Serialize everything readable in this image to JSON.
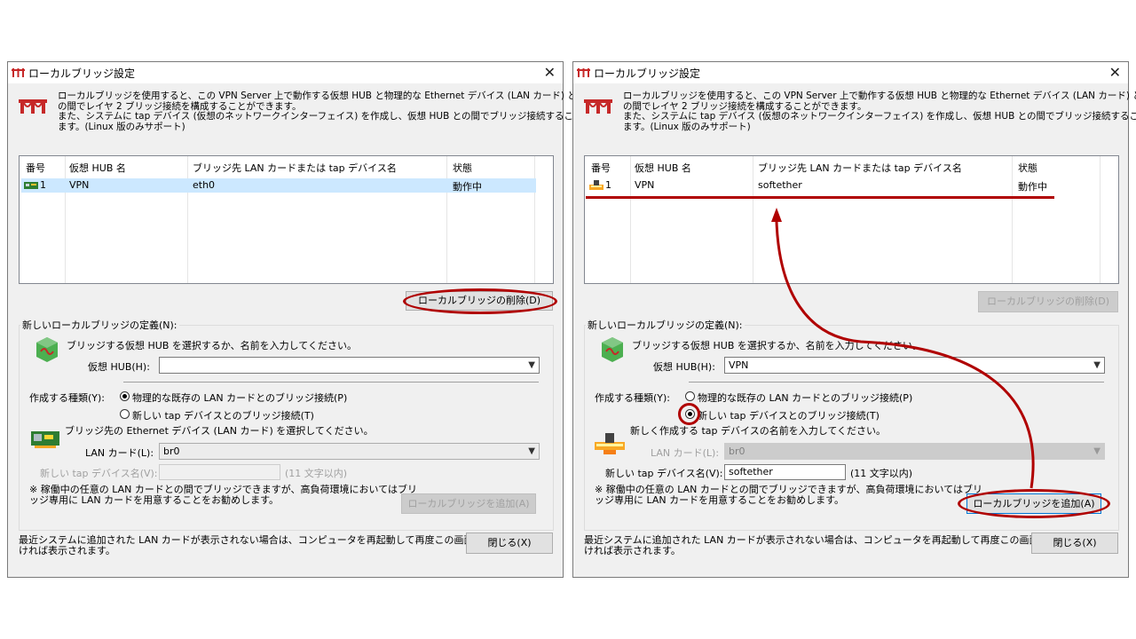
{
  "left": {
    "title": "ローカルブリッジ設定",
    "close": "✕",
    "description": [
      "ローカルブリッジを使用すると、この VPN Server 上で動作する仮想 HUB と物理的な Ethernet デバイス (LAN カード) と",
      "の間でレイヤ 2 ブリッジ接続を構成することができます。",
      "また、システムに tap デバイス (仮想のネットワークインターフェイス) を作成し、仮想 HUB との間でブリッジ接続することもでき",
      "ます。(Linux 版のみサポート)"
    ],
    "columns": [
      "番号",
      "仮想 HUB 名",
      "ブリッジ先 LAN カードまたは tap デバイス名",
      "状態"
    ],
    "row": {
      "num": "1",
      "hub": "VPN",
      "device": "eth0",
      "status": "動作中"
    },
    "delete_button": "ローカルブリッジの削除(D)",
    "group_title": "新しいローカルブリッジの定義(N):",
    "hub_instruction": "ブリッジする仮想 HUB を選択するか、名前を入力してください。",
    "hub_label": "仮想 HUB(H):",
    "hub_value": "",
    "type_label": "作成する種類(Y):",
    "radio_physical": "物理的な既存の LAN カードとのブリッジ接続(P)",
    "radio_tap": "新しい tap デバイスとのブリッジ接続(T)",
    "device_instruction": "ブリッジ先の Ethernet デバイス (LAN カード) を選択してください。",
    "lan_label": "LAN カード(L):",
    "lan_value": "br0",
    "tap_label": "新しい tap デバイス名(V):",
    "tap_value": "",
    "tap_hint": "(11 文字以内)",
    "note": [
      "※ 稼働中の任意の LAN カードとの間でブリッジできますが、高負荷環境においてはブリ",
      "ッジ専用に LAN カードを用意することをお勧めします。"
    ],
    "add_button": "ローカルブリッジを追加(A)",
    "footer": [
      "最近システムに追加された LAN カードが表示されない場合は、コンピュータを再起動して再度この画面を開",
      "ければ表示されます。"
    ],
    "close_button": "閉じる(X)"
  },
  "right": {
    "title": "ローカルブリッジ設定",
    "close": "✕",
    "description": [
      "ローカルブリッジを使用すると、この VPN Server 上で動作する仮想 HUB と物理的な Ethernet デバイス (LAN カード) と",
      "の間でレイヤ 2 ブリッジ接続を構成することができます。",
      "また、システムに tap デバイス (仮想のネットワークインターフェイス) を作成し、仮想 HUB との間でブリッジ接続することもでき",
      "ます。(Linux 版のみサポート)"
    ],
    "columns": [
      "番号",
      "仮想 HUB 名",
      "ブリッジ先 LAN カードまたは tap デバイス名",
      "状態"
    ],
    "row": {
      "num": "1",
      "hub": "VPN",
      "device": "softether",
      "status": "動作中"
    },
    "delete_button": "ローカルブリッジの削除(D)",
    "group_title": "新しいローカルブリッジの定義(N):",
    "hub_instruction": "ブリッジする仮想 HUB を選択するか、名前を入力してください。",
    "hub_label": "仮想 HUB(H):",
    "hub_value": "VPN",
    "type_label": "作成する種類(Y):",
    "radio_physical": "物理的な既存の LAN カードとのブリッジ接続(P)",
    "radio_tap": "新しい tap デバイスとのブリッジ接続(T)",
    "device_instruction": "新しく作成する tap デバイスの名前を入力してください。",
    "lan_label": "LAN カード(L):",
    "lan_value": "br0",
    "tap_label": "新しい tap デバイス名(V):",
    "tap_value": "softether",
    "tap_hint": "(11 文字以内)",
    "note": [
      "※ 稼働中の任意の LAN カードとの間でブリッジできますが、高負荷環境においてはブリ",
      "ッジ専用に LAN カードを用意することをお勧めします。"
    ],
    "add_button": "ローカルブリッジを追加(A)",
    "footer": [
      "最近システムに追加された LAN カードが表示されない場合は、コンピュータを再起動して再度この画面を開",
      "ければ表示されます。"
    ],
    "close_button": "閉じる(X)"
  },
  "colors": {
    "annotation": "#b00000",
    "selection": "#cce8ff",
    "focus": "#0078d7"
  }
}
